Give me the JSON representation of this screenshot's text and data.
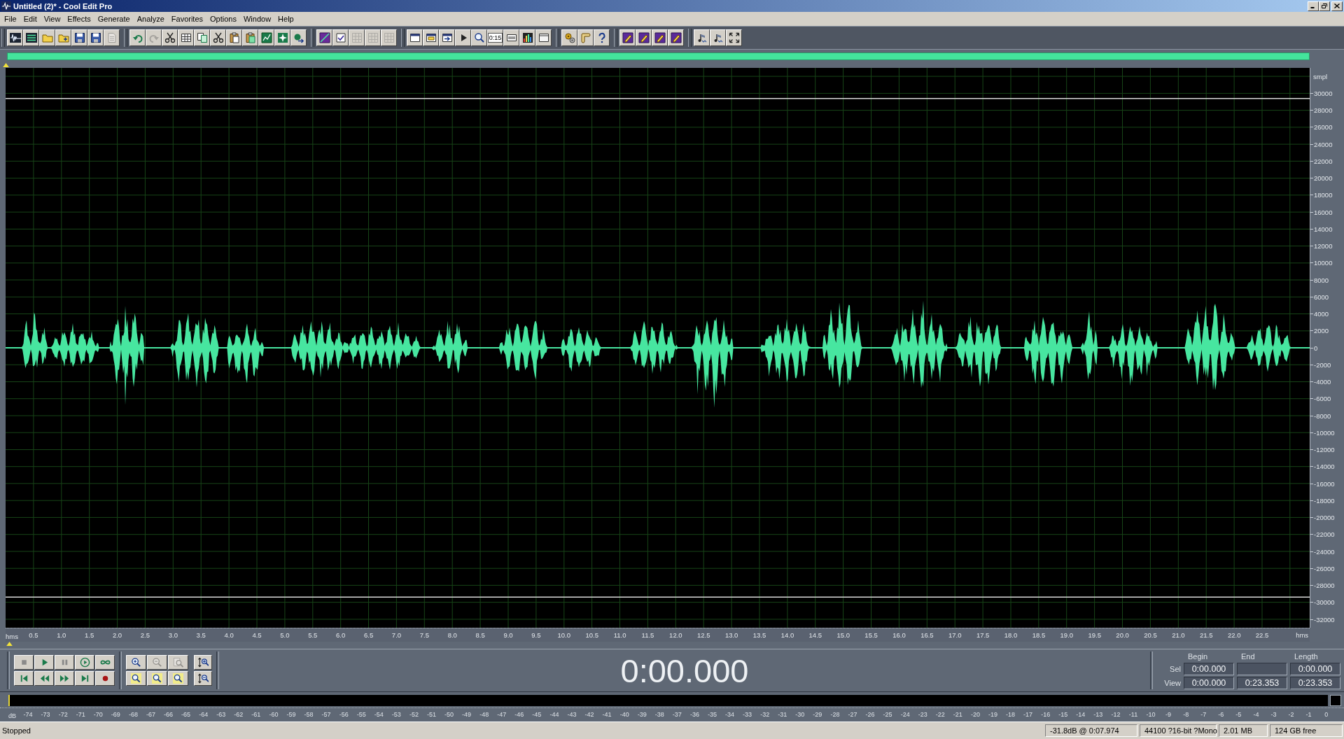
{
  "window": {
    "title": "Untitled (2)* - Cool Edit Pro"
  },
  "menu": [
    "File",
    "Edit",
    "View",
    "Effects",
    "Generate",
    "Analyze",
    "Favorites",
    "Options",
    "Window",
    "Help"
  ],
  "toolbar": {
    "groups": [
      {
        "buttons": [
          {
            "disabled": false
          },
          {
            "disabled": false
          },
          {
            "disabled": false
          },
          {
            "disabled": false
          },
          {
            "disabled": false
          },
          {
            "disabled": false
          },
          {
            "disabled": true
          }
        ]
      },
      {
        "buttons": [
          {
            "disabled": false
          },
          {
            "disabled": true
          },
          {
            "disabled": false
          },
          {
            "disabled": false
          },
          {
            "disabled": false
          },
          {
            "disabled": false
          },
          {
            "disabled": false
          },
          {
            "disabled": false
          },
          {
            "disabled": false
          },
          {
            "disabled": false
          },
          {
            "disabled": false
          }
        ]
      },
      {
        "buttons": [
          {
            "disabled": false
          },
          {
            "disabled": false
          },
          {
            "disabled": true
          },
          {
            "disabled": true
          },
          {
            "disabled": true
          }
        ]
      },
      {
        "buttons": [
          {
            "disabled": false
          },
          {
            "disabled": false
          },
          {
            "disabled": false
          },
          {
            "disabled": false
          },
          {
            "disabled": false
          },
          {
            "label": "0:15",
            "disabled": false
          },
          {
            "disabled": false
          },
          {
            "disabled": false
          },
          {
            "disabled": false
          }
        ]
      },
      {
        "buttons": [
          {
            "disabled": false
          },
          {
            "disabled": false
          },
          {
            "disabled": false
          }
        ]
      },
      {
        "buttons": [
          {
            "disabled": false
          },
          {
            "disabled": false
          },
          {
            "disabled": false
          },
          {
            "disabled": false
          }
        ]
      },
      {
        "buttons": [
          {
            "disabled": false
          },
          {
            "disabled": false
          },
          {
            "disabled": false
          }
        ]
      }
    ]
  },
  "waveform": {
    "amplitude_axis": {
      "unit": "smpl",
      "ticks": [
        "30000",
        "28000",
        "26000",
        "24000",
        "22000",
        "20000",
        "18000",
        "16000",
        "14000",
        "12000",
        "10000",
        "8000",
        "6000",
        "4000",
        "2000",
        "0",
        "-2000",
        "-4000",
        "-6000",
        "-8000",
        "-10000",
        "-12000",
        "-14000",
        "-16000",
        "-18000",
        "-20000",
        "-22000",
        "-24000",
        "-26000",
        "-28000",
        "-30000",
        "-32000"
      ]
    },
    "time_ruler": {
      "unit_left": "hms",
      "ticks": [
        "0.5",
        "1.0",
        "1.5",
        "2.0",
        "2.5",
        "3.0",
        "3.5",
        "4.0",
        "4.5",
        "5.0",
        "5.5",
        "6.0",
        "6.5",
        "7.0",
        "7.5",
        "8.0",
        "8.5",
        "9.0",
        "9.5",
        "10.0",
        "10.5",
        "11.0",
        "11.5",
        "12.0",
        "12.5",
        "13.0",
        "13.5",
        "14.0",
        "14.5",
        "15.0",
        "15.5",
        "16.0",
        "16.5",
        "17.0",
        "17.5",
        "18.0",
        "18.5",
        "19.0",
        "19.5",
        "20.0",
        "20.5",
        "21.0",
        "21.5",
        "22.0",
        "22.5"
      ],
      "unit_right": "hms"
    }
  },
  "zoom_buttons": [
    {
      "disabled": false
    },
    {
      "disabled": true
    },
    {
      "disabled": true
    },
    {
      "disabled": false
    },
    {
      "disabled": false
    },
    {
      "disabled": false
    }
  ],
  "time_display": "0:00.000",
  "selection_panel": {
    "columns": [
      "Begin",
      "End",
      "Length"
    ],
    "rows": [
      {
        "label": "Sel",
        "begin": "0:00.000",
        "length": "0:00.000"
      },
      {
        "label": "View",
        "begin": "0:00.000",
        "end": "0:23.353",
        "length": "0:23.353"
      }
    ]
  },
  "level_meter": {
    "unit": "dB",
    "ticks": [
      "-74",
      "-73",
      "-72",
      "-71",
      "-70",
      "-69",
      "-68",
      "-67",
      "-66",
      "-65",
      "-64",
      "-63",
      "-62",
      "-61",
      "-60",
      "-59",
      "-58",
      "-57",
      "-56",
      "-55",
      "-54",
      "-53",
      "-52",
      "-51",
      "-50",
      "-49",
      "-48",
      "-47",
      "-46",
      "-45",
      "-44",
      "-43",
      "-42",
      "-41",
      "-40",
      "-39",
      "-38",
      "-37",
      "-36",
      "-35",
      "-34",
      "-33",
      "-32",
      "-31",
      "-30",
      "-29",
      "-28",
      "-27",
      "-26",
      "-25",
      "-24",
      "-23",
      "-22",
      "-21",
      "-20",
      "-19",
      "-18",
      "-17",
      "-16",
      "-15",
      "-14",
      "-13",
      "-12",
      "-11",
      "-10",
      "-9",
      "-8",
      "-7",
      "-6",
      "-5",
      "-4",
      "-3",
      "-2",
      "-1",
      "0"
    ]
  },
  "status_bar": {
    "state": "Stopped",
    "cursor": "-31.8dB @ 0:07.974",
    "format": "44100 ?16-bit ?Mono",
    "size": "2.01 MB",
    "free_space": "124 GB free"
  }
}
